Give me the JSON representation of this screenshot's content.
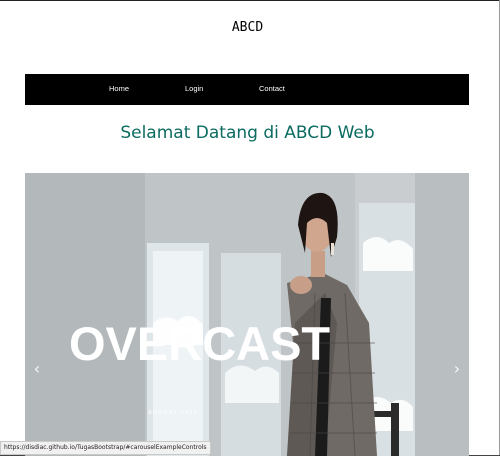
{
  "brand": {
    "title": "ABCD"
  },
  "nav": {
    "items": [
      {
        "label": "Home"
      },
      {
        "label": "Login"
      },
      {
        "label": "Contact"
      }
    ]
  },
  "main": {
    "heading": "Selamat Datang di ABCD Web"
  },
  "carousel": {
    "headline": "OVERCAST",
    "subline": "AUGUST 2021",
    "prev_symbol": "‹",
    "next_symbol": "›",
    "prev_icon": "chevron-left-icon",
    "next_icon": "chevron-right-icon"
  },
  "status_bar": {
    "url": "https://disdiac.github.io/TugasBootstrap/#carouselExampleControls"
  },
  "colors": {
    "navbar": "#000000",
    "heading": "#0b6b60",
    "text_light": "#ffffff"
  }
}
